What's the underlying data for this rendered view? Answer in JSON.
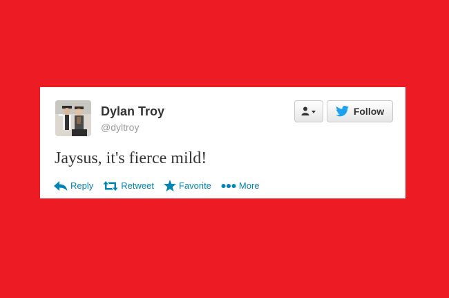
{
  "tweet": {
    "author_name": "Dylan Troy",
    "author_handle": "@dyltroy",
    "text": "Jaysus, it's fierce mild!"
  },
  "buttons": {
    "follow_label": "Follow"
  },
  "actions": [
    {
      "label": "Reply",
      "icon": "reply-icon"
    },
    {
      "label": "Retweet",
      "icon": "retweet-icon"
    },
    {
      "label": "Favorite",
      "icon": "star-icon"
    },
    {
      "label": "More",
      "icon": "more-dots-icon"
    }
  ],
  "colors": {
    "background": "#ed1c24",
    "link": "#0084b4",
    "twitter_bird": "#1da1f2"
  }
}
